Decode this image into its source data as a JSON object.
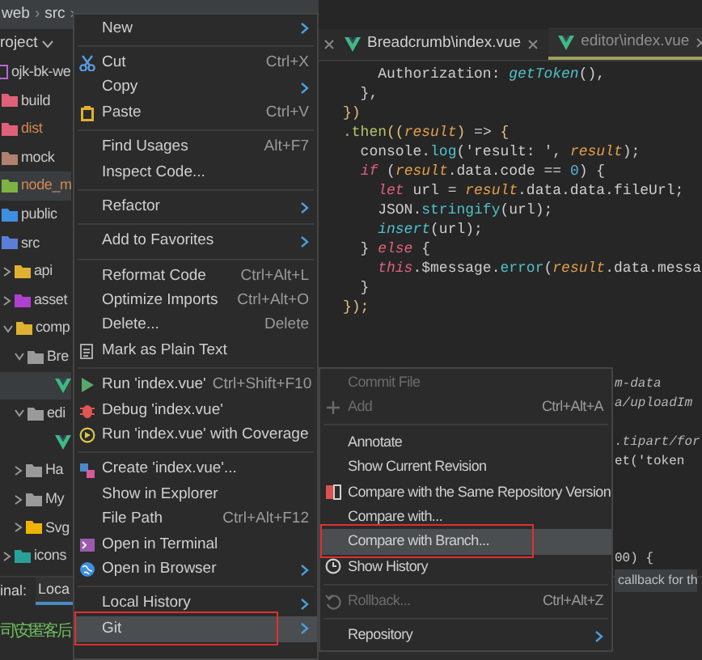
{
  "breadcrumb": {
    "items": [
      "web",
      "src"
    ],
    "separator": "›"
  },
  "project": {
    "header": "roject",
    "tree": [
      {
        "name": "ojk-bk-we",
        "kind": "module",
        "color": "#b36ad6",
        "children": [
          {
            "name": "build",
            "kind": "folder",
            "color": "#e0607a",
            "excluded": false
          },
          {
            "name": "dist",
            "kind": "folder",
            "color": "#e0607a",
            "excluded": true
          },
          {
            "name": "mock",
            "kind": "folder",
            "color": "#b08070",
            "excluded": false
          },
          {
            "name": "node_m",
            "kind": "folder",
            "color": "#7cb342",
            "excluded": true,
            "selected": true
          },
          {
            "name": "public",
            "kind": "folder",
            "color": "#3d8fe0",
            "excluded": false
          },
          {
            "name": "src",
            "kind": "folder",
            "color": "#5b7fd6",
            "excluded": false,
            "children": [
              {
                "name": "api",
                "kind": "folder",
                "color": "#e0b030",
                "expanded": false
              },
              {
                "name": "asset",
                "kind": "folder",
                "color": "#b040d0",
                "expanded": false
              },
              {
                "name": "comp",
                "kind": "folder",
                "color": "#e0b030",
                "expanded": true,
                "children": [
                  {
                    "name": "Bre",
                    "kind": "folder",
                    "color": "#9a9a9a",
                    "expanded": true,
                    "children": [
                      {
                        "kind": "vue",
                        "selected": true
                      }
                    ]
                  },
                  {
                    "name": "edi",
                    "kind": "folder",
                    "color": "#9a9a9a",
                    "expanded": true,
                    "children": [
                      {
                        "kind": "vue",
                        "selected": false
                      }
                    ]
                  },
                  {
                    "name": "Ha",
                    "kind": "folder",
                    "color": "#9a9a9a",
                    "expanded": false
                  },
                  {
                    "name": "My",
                    "kind": "folder",
                    "color": "#9a9a9a",
                    "expanded": false
                  },
                  {
                    "name": "Svg",
                    "kind": "folder",
                    "color": "#f0b400",
                    "expanded": false
                  }
                ]
              },
              {
                "name": "icons",
                "kind": "folder",
                "color": "#2aa198",
                "expanded": false
              }
            ]
          }
        ]
      }
    ]
  },
  "editor": {
    "tabs": [
      {
        "label": "Breadcrumb\\index.vue",
        "selected": false
      },
      {
        "label": "editor\\index.vue",
        "selected": true
      }
    ],
    "lines": [
      [
        {
          "t": "    Authorization: ",
          "color": "#cdcdcd"
        },
        {
          "t": "*getToken*",
          "color": "#4fc1c9"
        },
        {
          "t": "(),",
          "color": "#cdcdcd"
        }
      ],
      [
        {
          "t": "  },",
          "color": "#cdcdcd"
        }
      ],
      [
        {
          "t": "})",
          "color": "#e5c07b"
        }
      ],
      [
        {
          "t": ".then",
          "color": "#b5c46a"
        },
        {
          "t": "((",
          "color": "#e5c07b"
        },
        {
          "t": "*result*",
          "color": "#e5a04b"
        },
        {
          "t": ")",
          "color": "#e5c07b"
        },
        {
          "t": " => ",
          "color": "#cdcdcd"
        },
        {
          "t": "{",
          "color": "#e5c07b"
        }
      ],
      [
        {
          "t": "  console.",
          "color": "#cdcdcd"
        },
        {
          "t": "log",
          "color": "#4fc1c9"
        },
        {
          "t": "('result: ', ",
          "color": "#cdcdcd"
        },
        {
          "t": "*result*",
          "color": "#e5a04b"
        },
        {
          "t": ");",
          "color": "#cdcdcd"
        }
      ],
      [
        {
          "t": "  *if*",
          "color": "#e0607e"
        },
        {
          "t": " (",
          "color": "#cdcdcd"
        },
        {
          "t": "*result*",
          "color": "#e5a04b"
        },
        {
          "t": ".data.code == ",
          "color": "#cdcdcd"
        },
        {
          "t": "0",
          "color": "#5fb3e0"
        },
        {
          "t": ") {",
          "color": "#cdcdcd"
        }
      ],
      [
        {
          "t": "    *let*",
          "color": "#e0607e"
        },
        {
          "t": " url = ",
          "color": "#cdcdcd"
        },
        {
          "t": "*result*",
          "color": "#e5a04b"
        },
        {
          "t": ".data.data.fileUrl;",
          "color": "#cdcdcd"
        }
      ],
      [
        {
          "t": "    JSON.",
          "color": "#cdcdcd"
        },
        {
          "t": "stringify",
          "color": "#4fc1c9"
        },
        {
          "t": "(url);",
          "color": "#cdcdcd"
        }
      ],
      [
        {
          "t": "    *insert*",
          "color": "#4fc1c9"
        },
        {
          "t": "(url);",
          "color": "#cdcdcd"
        }
      ],
      [
        {
          "t": "  } ",
          "color": "#cdcdcd"
        },
        {
          "t": "*else*",
          "color": "#e0607e"
        },
        {
          "t": " {",
          "color": "#cdcdcd"
        }
      ],
      [
        {
          "t": "    *this*",
          "color": "#e0607e"
        },
        {
          "t": ".$message.",
          "color": "#cdcdcd"
        },
        {
          "t": "error",
          "color": "#4fc1c9"
        },
        {
          "t": "(",
          "color": "#cdcdcd"
        },
        {
          "t": "*result*",
          "color": "#e5a04b"
        },
        {
          "t": ".data.messa",
          "color": "#cdcdcd"
        }
      ],
      [
        {
          "t": "  }",
          "color": "#cdcdcd"
        }
      ],
      [
        {
          "t": "});",
          "color": "#e5c07b"
        }
      ]
    ],
    "tails": [
      [
        {
          "t": "*m-data*",
          "color": "#b5b5b5"
        }
      ],
      [
        {
          "t": "*a/uploadIm*",
          "color": "#b5b5b5"
        }
      ],
      [
        {
          "t": "*.tipart/for*",
          "color": "#b5b5b5"
        }
      ],
      [
        {
          "t": "et('token",
          "color": "#cdcdcd"
        }
      ],
      [
        {
          "t": "00) {",
          "color": "#cdcdcd"
        }
      ]
    ],
    "tooltip": "callback for th"
  },
  "context_menu": [
    {
      "kind": "item",
      "label": "New",
      "submenu": true
    },
    {
      "kind": "separator"
    },
    {
      "kind": "item",
      "label": "Cut",
      "shortcut": "Ctrl+X"
    },
    {
      "kind": "item",
      "label": "Copy",
      "submenu": true
    },
    {
      "kind": "item",
      "label": "Paste",
      "shortcut": "Ctrl+V"
    },
    {
      "kind": "separator"
    },
    {
      "kind": "item",
      "label": "Find Usages",
      "shortcut": "Alt+F7"
    },
    {
      "kind": "item",
      "label": "Inspect Code..."
    },
    {
      "kind": "separator"
    },
    {
      "kind": "item",
      "label": "Refactor",
      "submenu": true
    },
    {
      "kind": "separator"
    },
    {
      "kind": "item",
      "label": "Add to Favorites",
      "submenu": true
    },
    {
      "kind": "separator"
    },
    {
      "kind": "item",
      "label": "Reformat Code",
      "shortcut": "Ctrl+Alt+L"
    },
    {
      "kind": "item",
      "label": "Optimize Imports",
      "shortcut": "Ctrl+Alt+O"
    },
    {
      "kind": "item",
      "label": "Delete...",
      "shortcut": "Delete"
    },
    {
      "kind": "item",
      "label": "Mark as Plain Text"
    },
    {
      "kind": "separator"
    },
    {
      "kind": "item",
      "label": "Run 'index.vue'",
      "shortcut": "Ctrl+Shift+F10"
    },
    {
      "kind": "item",
      "label": "Debug 'index.vue'"
    },
    {
      "kind": "item",
      "label": "Run 'index.vue' with Coverage"
    },
    {
      "kind": "separator"
    },
    {
      "kind": "item",
      "label": "Create 'index.vue'..."
    },
    {
      "kind": "item",
      "label": "Show in Explorer"
    },
    {
      "kind": "item",
      "label": "File Path",
      "shortcut": "Ctrl+Alt+F12"
    },
    {
      "kind": "item",
      "label": "Open in Terminal"
    },
    {
      "kind": "item",
      "label": "Open in Browser",
      "submenu": true
    },
    {
      "kind": "separator"
    },
    {
      "kind": "item",
      "label": "Local History",
      "submenu": true
    },
    {
      "kind": "item",
      "label": "Git",
      "submenu": true,
      "selected": true,
      "annotated": true
    }
  ],
  "git_menu": [
    {
      "kind": "item",
      "label": "Commit File",
      "disabled": true
    },
    {
      "kind": "item",
      "label": "Add",
      "shortcut": "Ctrl+Alt+A",
      "disabled": true
    },
    {
      "kind": "separator"
    },
    {
      "kind": "item",
      "label": "Annotate"
    },
    {
      "kind": "item",
      "label": "Show Current Revision"
    },
    {
      "kind": "item",
      "label": "Compare with the Same Repository Version"
    },
    {
      "kind": "item",
      "label": "Compare with..."
    },
    {
      "kind": "item",
      "label": "Compare with Branch...",
      "selected": true,
      "annotated": true
    },
    {
      "kind": "item",
      "label": "Show History"
    },
    {
      "kind": "separator"
    },
    {
      "kind": "item",
      "label": "Rollback...",
      "shortcut": "Ctrl+Alt+Z",
      "disabled": true
    },
    {
      "kind": "separator"
    },
    {
      "kind": "item",
      "label": "Repository",
      "submenu": true
    }
  ],
  "terminal": {
    "title": "inal:",
    "tabs": [
      {
        "label": "Loca",
        "selected": true
      }
    ],
    "line": "司\\安匿客后"
  }
}
